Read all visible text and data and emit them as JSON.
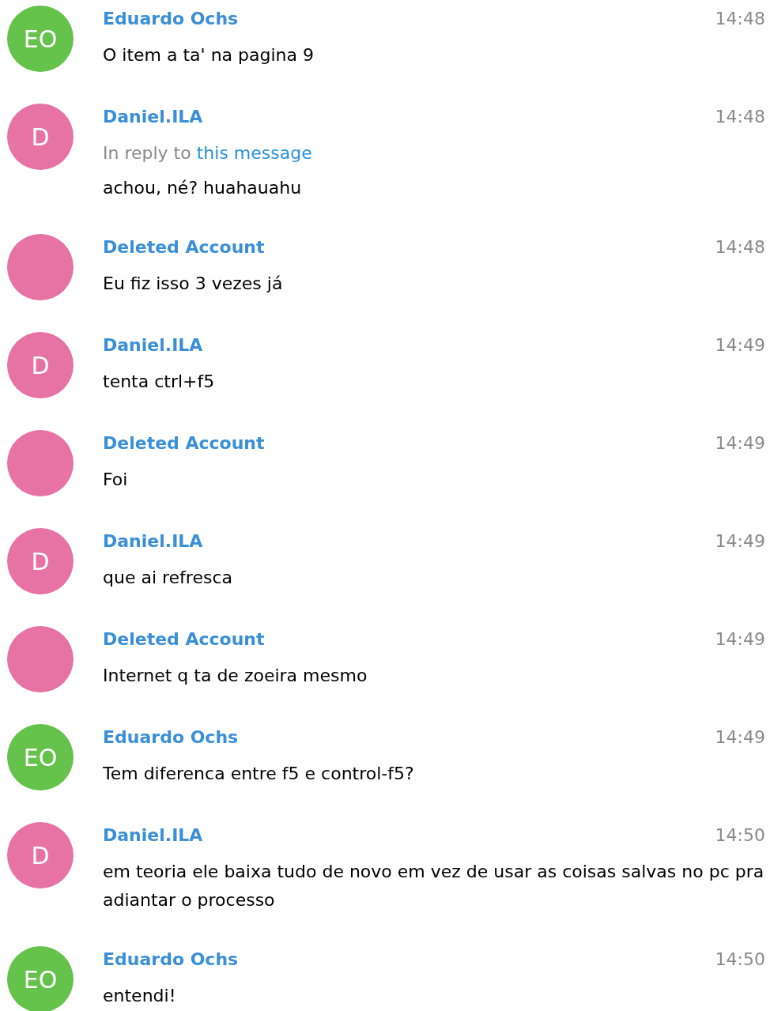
{
  "messages": [
    {
      "author": "Eduardo Ochs",
      "time": "14:48",
      "avatar": {
        "initials": "EO",
        "color": "#65c24b"
      },
      "text": "O item a ta' na pagina 9"
    },
    {
      "author": "Daniel.ILA",
      "time": "14:48",
      "avatar": {
        "initials": "D",
        "color": "#e673a4"
      },
      "reply": {
        "prefix": "In reply to",
        "link": "this message"
      },
      "text": "achou, né? huahauahu"
    },
    {
      "author": "Deleted Account",
      "time": "14:48",
      "avatar": {
        "color": "#e673a4"
      },
      "text": "Eu fiz isso 3 vezes já"
    },
    {
      "author": "Daniel.ILA",
      "time": "14:49",
      "avatar": {
        "initials": "D",
        "color": "#e673a4"
      },
      "text": "tenta ctrl+f5"
    },
    {
      "author": "Deleted Account",
      "time": "14:49",
      "avatar": {
        "color": "#e673a4"
      },
      "text": "Foi"
    },
    {
      "author": "Daniel.ILA",
      "time": "14:49",
      "avatar": {
        "initials": "D",
        "color": "#e673a4"
      },
      "text": "que ai refresca"
    },
    {
      "author": "Deleted Account",
      "time": "14:49",
      "avatar": {
        "color": "#e673a4"
      },
      "text": "Internet q ta de zoeira mesmo"
    },
    {
      "author": "Eduardo Ochs",
      "time": "14:49",
      "avatar": {
        "initials": "EO",
        "color": "#65c24b"
      },
      "text": "Tem diferenca entre f5 e control-f5?"
    },
    {
      "author": "Daniel.ILA",
      "time": "14:50",
      "avatar": {
        "initials": "D",
        "color": "#e673a4"
      },
      "text": "em teoria ele baixa tudo de novo em vez de usar as coisas salvas no pc pra adiantar o processo"
    },
    {
      "author": "Eduardo Ochs",
      "time": "14:50",
      "avatar": {
        "initials": "EO",
        "color": "#65c24b"
      },
      "text": "entendi!"
    }
  ]
}
